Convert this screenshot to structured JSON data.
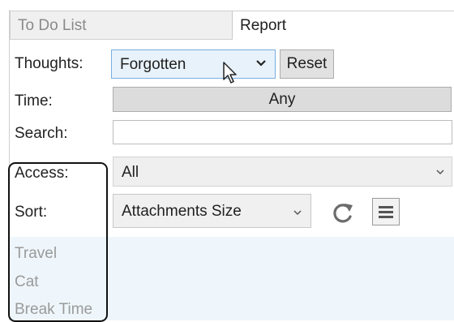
{
  "tabs": [
    {
      "label": "To Do List",
      "active": false
    },
    {
      "label": "Report",
      "active": true
    }
  ],
  "filters": {
    "thoughts": {
      "label": "Thoughts:",
      "value": "Forgotten",
      "reset_label": "Reset"
    },
    "time": {
      "label": "Time:",
      "value": "Any"
    },
    "search": {
      "label": "Search:",
      "value": "",
      "placeholder": ""
    },
    "access": {
      "label": "Access:",
      "value": "All"
    },
    "sort": {
      "label": "Sort:",
      "value": "Attachments Size"
    }
  },
  "list_items": [
    "Travel",
    "Cat",
    "Break Time"
  ],
  "icons": {
    "refresh": "refresh-icon",
    "menu": "hamburger-menu-icon",
    "chevron": "chevron-down-icon",
    "cursor": "mouse-pointer-icon"
  },
  "colors": {
    "accent_border": "#7aaee0",
    "selected_fill": "#e8f2fb",
    "list_background": "#eef6fb",
    "muted_text": "#9a9a9a"
  }
}
